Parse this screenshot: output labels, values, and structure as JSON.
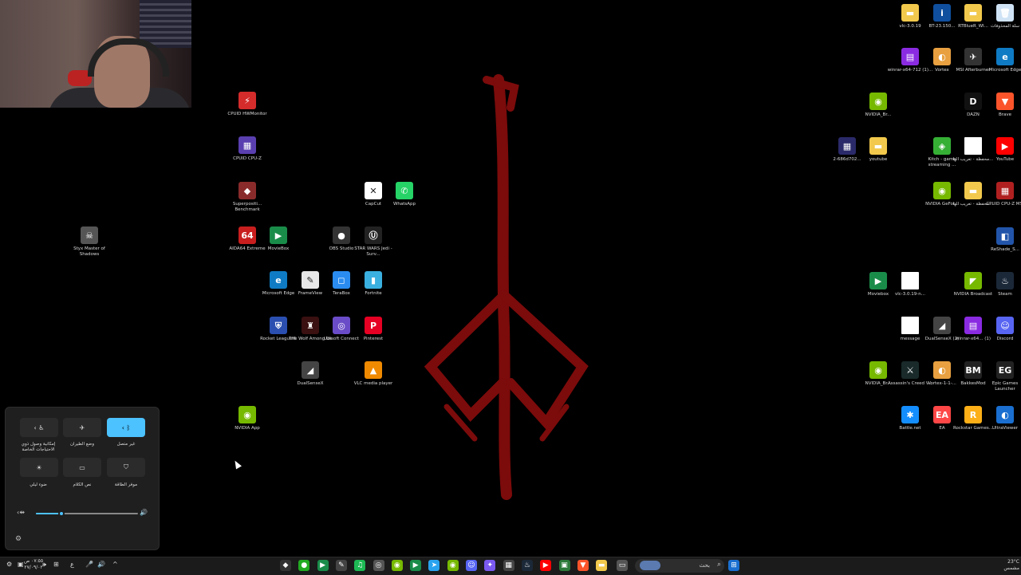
{
  "desktop": {
    "icons_left": [
      {
        "label": "CPUID HWMonitor",
        "color": "#d42b2b",
        "glyph": "⚡"
      },
      {
        "label": "CPUID CPU-Z",
        "color": "#5a3fb0",
        "glyph": "▦"
      },
      {
        "label": "Superpositi... Benchmark",
        "color": "#8a2b2b",
        "glyph": "◆"
      },
      {
        "label": "AIDA64 Extreme",
        "color": "#c81e1e",
        "glyph": "64"
      },
      {
        "label": "MovieBox",
        "color": "#1a8c4a",
        "glyph": "▶"
      },
      {
        "label": "OBS Studio",
        "color": "#333",
        "glyph": "●"
      },
      {
        "label": "STAR WARS Jedi - Surv...",
        "color": "#222",
        "glyph": "Ⓤ"
      },
      {
        "label": "CapCut",
        "color": "#fff",
        "glyph": "✕"
      },
      {
        "label": "WhatsApp",
        "color": "#25d366",
        "glyph": "✆"
      },
      {
        "label": "Microsoft Edge",
        "color": "#0f7bc4",
        "glyph": "e"
      },
      {
        "label": "FrameView",
        "color": "#e8e8e8",
        "glyph": "✎"
      },
      {
        "label": "TeraBox",
        "color": "#2a8cf0",
        "glyph": "◻"
      },
      {
        "label": "Fortnite",
        "color": "#3ab0e0",
        "glyph": "▮"
      },
      {
        "label": "Rocket League®",
        "color": "#2b4fb0",
        "glyph": "⛨"
      },
      {
        "label": "The Wolf Among Us",
        "color": "#3a1010",
        "glyph": "♜"
      },
      {
        "label": "Ubisoft Connect",
        "color": "#6a4cc8",
        "glyph": "◎"
      },
      {
        "label": "Pinterest",
        "color": "#e60023",
        "glyph": "P"
      },
      {
        "label": "DualSenseX",
        "color": "#444",
        "glyph": "◢"
      },
      {
        "label": "VLC media player",
        "color": "#f08a00",
        "glyph": "▲"
      },
      {
        "label": "NVIDIA App",
        "color": "#76b900",
        "glyph": "◉"
      },
      {
        "label": "Styx Master of Shadows",
        "color": "#555",
        "glyph": "☠"
      }
    ],
    "icons_right": [
      {
        "label": "vlc-3.0.19",
        "color": "#f2c94c",
        "glyph": "▬"
      },
      {
        "label": "BT-23.150...",
        "color": "#0f4f9e",
        "glyph": "i"
      },
      {
        "label": "RTBlueR_WI...",
        "color": "#f2c94c",
        "glyph": "▬"
      },
      {
        "label": "سلة المحذوفات",
        "color": "#cfe3f5",
        "glyph": "🗑"
      },
      {
        "label": "winrar-x64-712 (1)...",
        "color": "#8a2be2",
        "glyph": "▤"
      },
      {
        "label": "Vortex",
        "color": "#e8a040",
        "glyph": "◐"
      },
      {
        "label": "MSI Afterburner",
        "color": "#333",
        "glyph": "✈"
      },
      {
        "label": "Microsoft Edge",
        "color": "#0f7bc4",
        "glyph": "e"
      },
      {
        "label": "NVIDIA_Br...",
        "color": "#76b900",
        "glyph": "◉"
      },
      {
        "label": "DAZN",
        "color": "#111",
        "glyph": "D"
      },
      {
        "label": "Brave",
        "color": "#fb542b",
        "glyph": "▼"
      },
      {
        "label": "2-686d702...",
        "color": "#2a2a6a",
        "glyph": "▦"
      },
      {
        "label": "youtube",
        "color": "#f2c94c",
        "glyph": "▬"
      },
      {
        "label": "Kitch - game streaming ...",
        "color": "#35b035",
        "glyph": "◈"
      },
      {
        "label": "محفظة - تعريب الها...",
        "color": "#fff",
        "glyph": ""
      },
      {
        "label": "YouTube",
        "color": "#ff0000",
        "glyph": "▶"
      },
      {
        "label": "NVIDIA GeFor...",
        "color": "#76b900",
        "glyph": "◉"
      },
      {
        "label": "محفظة - تعريب الها...",
        "color": "#f2c94c",
        "glyph": "▬"
      },
      {
        "label": "CPUID CPU-Z MSI",
        "color": "#b02020",
        "glyph": "▦"
      },
      {
        "label": "ReShade_S...",
        "color": "#2255aa",
        "glyph": "◧"
      },
      {
        "label": "Moviebox",
        "color": "#1a8c4a",
        "glyph": "▶"
      },
      {
        "label": "vlc-3.0.19-n...",
        "color": "#fff",
        "glyph": ""
      },
      {
        "label": "NVIDIA Broadcast",
        "color": "#76b900",
        "glyph": "◤"
      },
      {
        "label": "Steam",
        "color": "#1b2838",
        "glyph": "♨"
      },
      {
        "label": "message",
        "color": "#fff",
        "glyph": ""
      },
      {
        "label": "DualSenseX (2)",
        "color": "#444",
        "glyph": "◢"
      },
      {
        "label": "winrar-x64... (1)",
        "color": "#8a2be2",
        "glyph": "▤"
      },
      {
        "label": "Discord",
        "color": "#5865f2",
        "glyph": "☺"
      },
      {
        "label": "NVIDIA_Br...",
        "color": "#76b900",
        "glyph": "◉"
      },
      {
        "label": "Assassin's Creed V...",
        "color": "#1a2a2a",
        "glyph": "⚔"
      },
      {
        "label": "Vortex-1-1-...",
        "color": "#e8a040",
        "glyph": "◐"
      },
      {
        "label": "BakkesMod",
        "color": "#222",
        "glyph": "BM"
      },
      {
        "label": "Epic Games Launcher",
        "color": "#222",
        "glyph": "EG"
      },
      {
        "label": "Battle.net",
        "color": "#148eff",
        "glyph": "✱"
      },
      {
        "label": "EA",
        "color": "#ff4747",
        "glyph": "EA"
      },
      {
        "label": "Rockstar Games...",
        "color": "#fcaf17",
        "glyph": "R"
      },
      {
        "label": "UltraViewer",
        "color": "#1a6fd0",
        "glyph": "◐"
      }
    ]
  },
  "quick_settings": {
    "tiles": [
      {
        "label": "إمكانية وصول ذوي الاحتياجات الخاصة",
        "icon": "‹ ♿",
        "active": false
      },
      {
        "label": "وضع الطيران",
        "icon": "✈",
        "active": false
      },
      {
        "label": "غير متصل",
        "icon": "‹ ᛒ",
        "active": true
      },
      {
        "label": "ضوء ليلي",
        "icon": "☀",
        "active": false
      },
      {
        "label": "نص الكلام",
        "icon": "▭",
        "active": false
      },
      {
        "label": "موفر الطاقة",
        "icon": "⛉",
        "active": false
      }
    ],
    "volume_level": 0.25,
    "settings_icon": "⚙"
  },
  "taskbar": {
    "search_placeholder": "بحث",
    "weather": "23°C",
    "weather_sub": "مشمس",
    "time": "٠٧:٥٥ ص",
    "date": "٢٧/٠٩/٠٢",
    "apps": [
      {
        "name": "inkscape",
        "color": "#333",
        "glyph": "◆"
      },
      {
        "name": "chrome",
        "color": "#2a2",
        "glyph": "●"
      },
      {
        "name": "moviebox",
        "color": "#1a8c4a",
        "glyph": "▶"
      },
      {
        "name": "notepad",
        "color": "#444",
        "glyph": "✎"
      },
      {
        "name": "spotify",
        "color": "#1db954",
        "glyph": "♫"
      },
      {
        "name": "obs",
        "color": "#555",
        "glyph": "◎"
      },
      {
        "name": "nvidia",
        "color": "#76b900",
        "glyph": "◉"
      },
      {
        "name": "moviebox2",
        "color": "#1a8c4a",
        "glyph": "▶"
      },
      {
        "name": "telegram",
        "color": "#2aa3ef",
        "glyph": "➤"
      },
      {
        "name": "nvidia2",
        "color": "#76b900",
        "glyph": "◉"
      },
      {
        "name": "discord",
        "color": "#5865f2",
        "glyph": "☺"
      },
      {
        "name": "copilot",
        "color": "#7a5af0",
        "glyph": "✦"
      },
      {
        "name": "calculator",
        "color": "#444",
        "glyph": "▦"
      },
      {
        "name": "steam",
        "color": "#1b2838",
        "glyph": "♨"
      },
      {
        "name": "youtube",
        "color": "#ff0000",
        "glyph": "▶"
      },
      {
        "name": "photos",
        "color": "#2d7a3a",
        "glyph": "▣"
      },
      {
        "name": "brave",
        "color": "#fb542b",
        "glyph": "▼"
      },
      {
        "name": "explorer",
        "color": "#f2c94c",
        "glyph": "▬"
      },
      {
        "name": "tablet",
        "color": "#555",
        "glyph": "▭"
      }
    ],
    "tray": [
      "⚙",
      "▣",
      "🕪",
      "⊞",
      "ع",
      "🎤",
      "🔊",
      "^"
    ]
  }
}
